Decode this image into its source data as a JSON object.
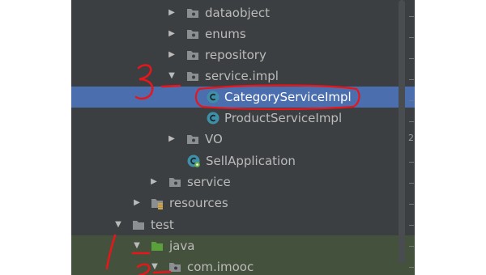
{
  "project_tree": {
    "items": [
      {
        "label": "dataobject",
        "type": "package",
        "state": "collapsed"
      },
      {
        "label": "enums",
        "type": "package",
        "state": "collapsed"
      },
      {
        "label": "repository",
        "type": "package",
        "state": "collapsed"
      },
      {
        "label": "service.impl",
        "type": "package",
        "state": "expanded"
      },
      {
        "label": "CategoryServiceImpl",
        "type": "class",
        "selected": true
      },
      {
        "label": "ProductServiceImpl",
        "type": "class"
      },
      {
        "label": "VO",
        "type": "package",
        "state": "collapsed"
      },
      {
        "label": "SellApplication",
        "type": "spring-class"
      },
      {
        "label": "service",
        "type": "package",
        "state": "collapsed"
      },
      {
        "label": "resources",
        "type": "resources-folder",
        "state": "collapsed"
      },
      {
        "label": "test",
        "type": "folder",
        "state": "expanded"
      },
      {
        "label": "java",
        "type": "test-source-folder",
        "state": "expanded"
      },
      {
        "label": "com.imooc",
        "type": "package",
        "state": "expanded"
      }
    ],
    "gutter_number": "2"
  },
  "colors": {
    "panel_bg": "#3c3f41",
    "selection": "#4b6eaf",
    "text": "#bbbbbb",
    "folder_icon": "#8c8f91",
    "class_icon": "#3f8fa8",
    "test_folder": "#5aa03b",
    "annotation_red": "#e8161b"
  },
  "icons": {
    "package": "folder-icon",
    "class": "class-c-icon",
    "spring": "spring-boot-class-icon",
    "resources": "resources-folder-icon",
    "test": "test-folder-icon"
  }
}
